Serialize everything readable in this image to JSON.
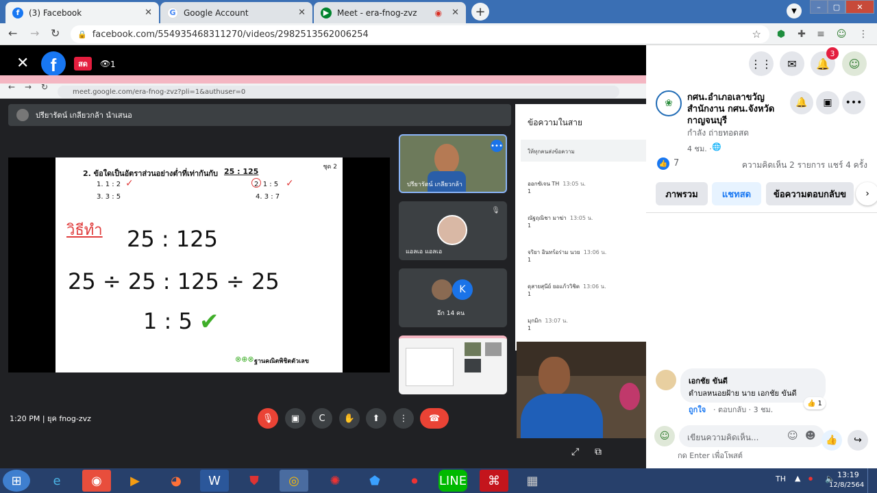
{
  "browser": {
    "tabs": [
      {
        "label": "(3) Facebook",
        "icon": "facebook-icon",
        "active": true
      },
      {
        "label": "Google Account",
        "icon": "google-icon",
        "active": false
      },
      {
        "label": "Meet - era-fnog-zvz",
        "icon": "meet-icon",
        "active": false
      }
    ],
    "url": "facebook.com/554935468311270/videos/2982513562006254"
  },
  "live_overlay": {
    "live_badge": "สด",
    "viewer_count": "1"
  },
  "meet": {
    "inner_url": "meet.google.com/era-fnog-zvz?pli=1&authuser=0",
    "presenter_bar": "ปรียารัตน์ เกลียวกล้า นำเสนอ",
    "slide": {
      "page_tag": "ชุด 2",
      "question": "2. ข้อใดเป็นอัตราส่วนอย่างต่ำที่เท่ากันกับ",
      "question_ratio": "25 : 125",
      "opt1": "1. 1 : 2",
      "opt2": "2. 1 : 5",
      "opt3": "3. 3 : 5",
      "opt4": "4. 3 : 7",
      "method": "วิธีทำ",
      "line1": "25 : 125",
      "line2": "25 ÷ 25 : 125 ÷ 25",
      "line3": "1 : 5",
      "brand": "ฐานคณิตพิชิตตัวเลข"
    },
    "tiles": {
      "tile1_name": "ปรียารัตน์ เกลียวกล้า",
      "tile2_name": "แอลเอ แอลเอ",
      "tile3_avatar_letter": "K",
      "tile3_label": "อีก 14 คน"
    },
    "chat": {
      "title": "ข้อความในสาย",
      "notice": "ให้ทุกคนส่งข้อความ",
      "messages": [
        {
          "sender": "ออกขัเจน TH",
          "time": "13:05 น.",
          "text": "1"
        },
        {
          "sender": "ณัฐฤณิชา มาฆ่า",
          "time": "13:05 น.",
          "text": "1"
        },
        {
          "sender": "จริยา อินทร์อร่าม นวย",
          "time": "13:06 น.",
          "text": "1"
        },
        {
          "sender": "ดุสายสุนีย์ ยอแก้ววิชิต",
          "time": "13:06 น.",
          "text": "1"
        },
        {
          "sender": "มุกมิก",
          "time": "13:07 น.",
          "text": "1"
        }
      ]
    },
    "bottom_left": "1:20 PM  |  ยุค fnog-zvz"
  },
  "fb": {
    "notification_count": "3",
    "page_name": "กศน.อำเภอเลาขวัญ สำนักงาน กศน.จังหวัดกาญจนบุรี",
    "page_status": "กำลัง ถ่ายทอดสด",
    "post_time": "4 ชม. ·",
    "like_count": "7",
    "stats": "ความคิดเห็น 2 รายการ  แชร์ 4 ครั้ง",
    "tabs": [
      "ภาพรวม",
      "แชทสด",
      "ข้อความตอบกลับข"
    ],
    "comment": {
      "author": "เอกชัย ขันดี",
      "text": "ตำบลหนอยฝ้าย นาย เอกชัย ขันดี",
      "like_action": "ถูกใจ",
      "meta": "· ตอบกลับ · 3 ชม.",
      "reaction_count": "1"
    },
    "comment_placeholder": "เขียนความคิดเห็น...",
    "enter_hint": "กด Enter เพื่อโพสต์"
  },
  "taskbar": {
    "lang": "TH",
    "time": "13:19",
    "date": "12/8/2564"
  },
  "colors": {
    "facebook_blue": "#1877f2",
    "meet_red": "#ea4335",
    "taskbar": "#27406b"
  }
}
